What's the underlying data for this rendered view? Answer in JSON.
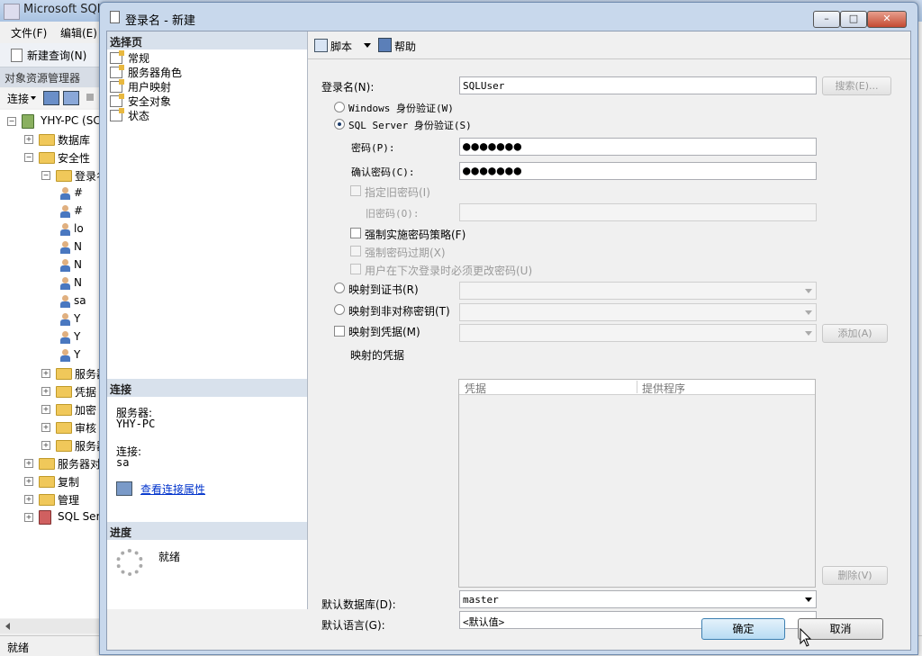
{
  "app": {
    "title": "Microsoft SQL",
    "menu": [
      "文件(F)",
      "编辑(E)"
    ],
    "toolbar": {
      "new_query": "新建查询(N)"
    },
    "object_explorer": {
      "title": "对象资源管理器",
      "connect_label": "连接",
      "tree": [
        {
          "label": "YHY-PC (SC",
          "indent": 0,
          "icon": "server-icon",
          "expander": "minus"
        },
        {
          "label": "数据库",
          "indent": 1,
          "icon": "folder-icon",
          "expander": "plus"
        },
        {
          "label": "安全性",
          "indent": 1,
          "icon": "folder-icon",
          "expander": "minus"
        },
        {
          "label": "登录名",
          "indent": 2,
          "icon": "folder-icon",
          "expander": "minus"
        },
        {
          "label": "#",
          "indent": 3,
          "icon": "login-user-icon"
        },
        {
          "label": "#",
          "indent": 3,
          "icon": "login-user-icon"
        },
        {
          "label": "lo",
          "indent": 3,
          "icon": "login-user-icon"
        },
        {
          "label": "N",
          "indent": 3,
          "icon": "login-user-icon"
        },
        {
          "label": "N",
          "indent": 3,
          "icon": "login-user-icon"
        },
        {
          "label": "N",
          "indent": 3,
          "icon": "login-user-icon"
        },
        {
          "label": "sa",
          "indent": 3,
          "icon": "login-user-icon"
        },
        {
          "label": "Y",
          "indent": 3,
          "icon": "login-user-icon"
        },
        {
          "label": "Y",
          "indent": 3,
          "icon": "login-user-icon"
        },
        {
          "label": "Y",
          "indent": 3,
          "icon": "login-user-icon"
        },
        {
          "label": "服务器",
          "indent": 2,
          "icon": "folder-icon",
          "expander": "plus"
        },
        {
          "label": "凭据",
          "indent": 2,
          "icon": "folder-icon",
          "expander": "plus"
        },
        {
          "label": "加密",
          "indent": 2,
          "icon": "folder-icon",
          "expander": "plus"
        },
        {
          "label": "审核",
          "indent": 2,
          "icon": "folder-icon",
          "expander": "plus"
        },
        {
          "label": "服务器",
          "indent": 2,
          "icon": "folder-icon",
          "expander": "plus"
        },
        {
          "label": "服务器对",
          "indent": 1,
          "icon": "folder-icon",
          "expander": "plus"
        },
        {
          "label": "复制",
          "indent": 1,
          "icon": "folder-icon",
          "expander": "plus"
        },
        {
          "label": "管理",
          "indent": 1,
          "icon": "folder-icon",
          "expander": "plus"
        },
        {
          "label": "SQL Ser",
          "indent": 1,
          "icon": "agent-icon",
          "expander": "plus"
        }
      ]
    },
    "status": "就绪"
  },
  "dialog": {
    "title": "登录名 - 新建",
    "window_buttons": {
      "minimize": "–",
      "maximize": "□",
      "close": "✕"
    },
    "select_page": {
      "header": "选择页",
      "items": [
        "常规",
        "服务器角色",
        "用户映射",
        "安全对象",
        "状态"
      ]
    },
    "connection": {
      "header": "连接",
      "server_label": "服务器:",
      "server_value": "YHY-PC",
      "connection_label": "连接:",
      "connection_value": "sa",
      "view_link": "查看连接属性"
    },
    "progress": {
      "header": "进度",
      "status": "就绪"
    },
    "toolbar": {
      "script": "脚本",
      "help": "帮助"
    },
    "form": {
      "login_name_label": "登录名(N):",
      "login_name_value": "SQLUser",
      "search_button": "搜索(E)...",
      "windows_auth": "Windows 身份验证(W)",
      "sql_auth": "SQL Server 身份验证(S)",
      "auth_selected": "sql",
      "password_label": "密码(P):",
      "password_value": "●●●●●●●",
      "confirm_label": "确认密码(C):",
      "confirm_value": "●●●●●●●",
      "specify_old_password": "指定旧密码(I)",
      "old_password_label": "旧密码(O):",
      "enforce_policy": "强制实施密码策略(F)",
      "enforce_expiration": "强制密码过期(X)",
      "must_change": "用户在下次登录时必须更改密码(U)",
      "map_certificate": "映射到证书(R)",
      "map_asymmetric_key": "映射到非对称密钥(T)",
      "map_credential": "映射到凭据(M)",
      "add_button": "添加(A)",
      "mapped_credentials_label": "映射的凭据",
      "grid_columns": [
        "凭据",
        "提供程序"
      ],
      "remove_button": "删除(V)",
      "default_db_label": "默认数据库(D):",
      "default_db_value": "master",
      "default_lang_label": "默认语言(G):",
      "default_lang_value": "<默认值>"
    },
    "buttons": {
      "ok": "确定",
      "cancel": "取消"
    }
  }
}
